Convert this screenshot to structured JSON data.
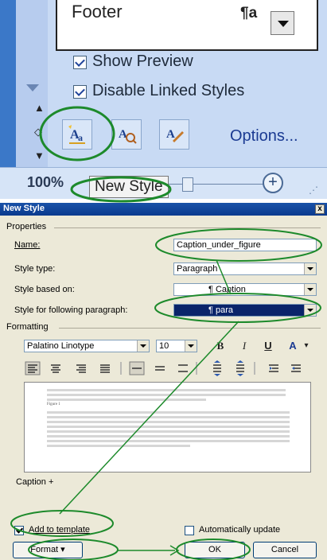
{
  "styles_pane": {
    "list_item": "Footer",
    "para_mark": "¶a",
    "show_preview_label": "Show Preview",
    "disable_linked_label": "Disable Linked Styles",
    "options_link": "Options...",
    "zoom_percent": "100%",
    "tooltip": "New Style",
    "checkbox_states": {
      "show_preview": true,
      "disable_linked_styles": true
    },
    "icons": [
      "new-style-icon",
      "style-inspector-icon",
      "manage-styles-icon"
    ]
  },
  "dialog": {
    "title": "New Style",
    "close": "x",
    "properties_heading": "Properties",
    "name_label": "Name:",
    "name_value": "Caption_under_figure",
    "style_type_label": "Style type:",
    "style_type_value": "Paragraph",
    "based_on_label": "Style based on:",
    "based_on_value": "¶ Caption",
    "following_label": "Style for following paragraph:",
    "following_value": "¶ para",
    "formatting_heading": "Formatting",
    "font_value": "Palatino Linotype",
    "size_value": "10",
    "bold": "B",
    "italic": "I",
    "underline": "U",
    "color": "A",
    "preview_sample": "Figure 1",
    "description": "Caption +",
    "add_to_template_label": "Add to template",
    "add_to_template_checked": true,
    "auto_update_label": "Automatically update",
    "auto_update_checked": false,
    "format_button": "Format ▾",
    "ok_button": "OK",
    "cancel_button": "Cancel"
  },
  "colors": {
    "annotation": "#1d8a2b",
    "title_bar": "#0a3a8e",
    "pane_bg": "#c8daf4"
  }
}
